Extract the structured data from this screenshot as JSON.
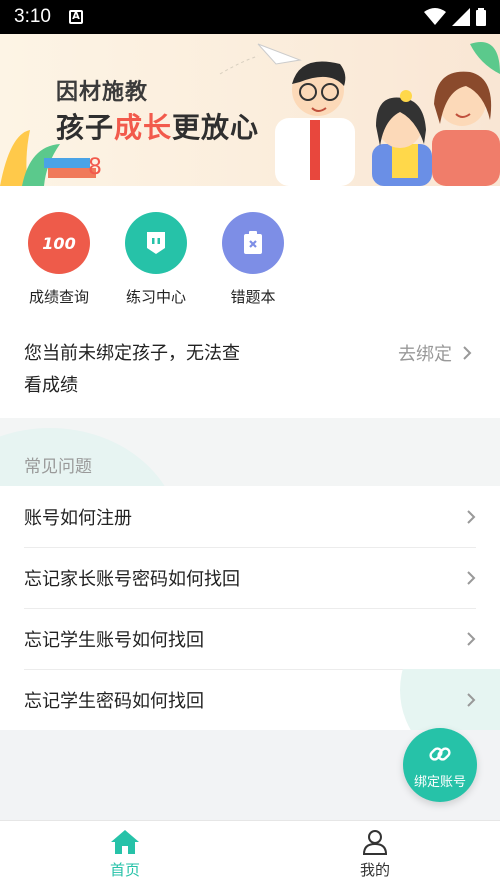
{
  "status_bar": {
    "time": "3:10",
    "app_badge": "A"
  },
  "banner": {
    "line1": "因材施教",
    "line2_part1": "孩子",
    "line2_highlight": "成长",
    "line2_part2": "更放心",
    "highlight_color": "#f25a4c"
  },
  "shortcuts": [
    {
      "label": "成绩查询",
      "icon": "score-100-icon",
      "color": "#ee5b4a",
      "glyph": "100"
    },
    {
      "label": "练习中心",
      "icon": "practice-icon",
      "color": "#26c2a8"
    },
    {
      "label": "错题本",
      "icon": "wrong-book-icon",
      "color": "#7d8ee6"
    }
  ],
  "bind_notice": {
    "text": "您当前未绑定孩子，无法查看成绩",
    "action": "去绑定"
  },
  "faq": {
    "title": "常见问题",
    "items": [
      {
        "text": "账号如何注册"
      },
      {
        "text": "忘记家长账号密码如何找回"
      },
      {
        "text": "忘记学生账号如何找回"
      },
      {
        "text": "忘记学生密码如何找回"
      }
    ]
  },
  "fab": {
    "label": "绑定账号"
  },
  "bottom_nav": {
    "items": [
      {
        "label": "首页",
        "icon": "home-icon",
        "active": true
      },
      {
        "label": "我的",
        "icon": "user-icon",
        "active": false
      }
    ],
    "accent": "#26c2a8"
  }
}
